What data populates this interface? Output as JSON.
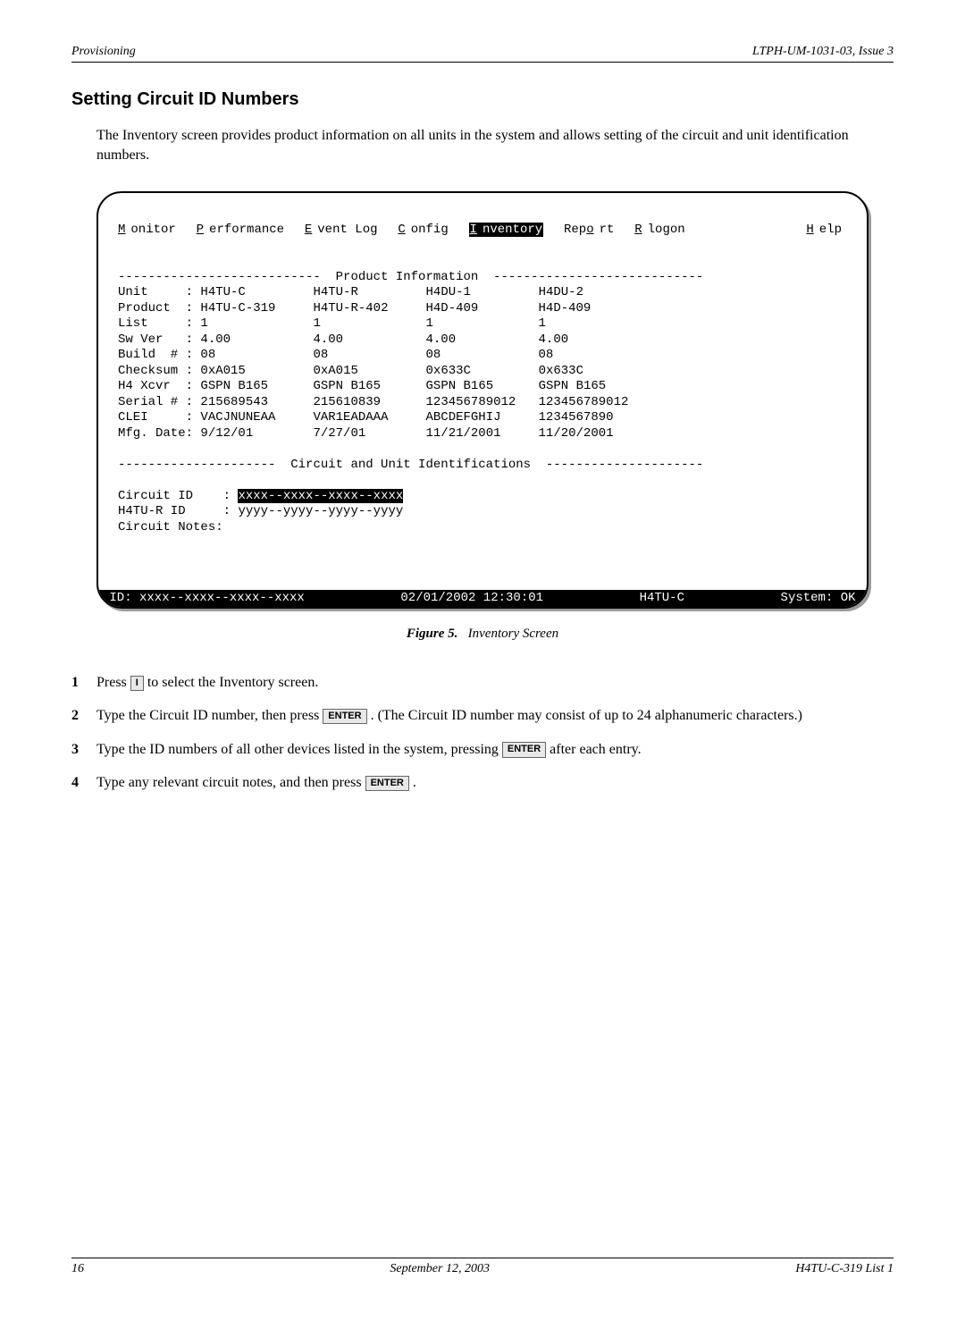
{
  "header": {
    "left": "Provisioning",
    "right": "LTPH-UM-1031-03, Issue 3"
  },
  "title": "Setting Circuit ID Numbers",
  "intro": "The Inventory screen provides product information on all units in the system and allows setting of the circuit and unit identification numbers.",
  "terminal": {
    "menu": {
      "monitor": "Monitor",
      "performance": "Performance",
      "eventlog": "Event Log",
      "config": "Config",
      "inventory": "Inventory",
      "report": "Report",
      "rlogon": "Rlogon",
      "help": "Help"
    },
    "section1_title": "Product Information",
    "labels": {
      "unit": "Unit     :",
      "product": "Product  :",
      "list": "List     :",
      "swver": "Sw Ver   :",
      "build": "Build  # :",
      "checksum": "Checksum :",
      "h4xcvr": "H4 Xcvr  :",
      "serial": "Serial # :",
      "clei": "CLEI     :",
      "mfg": "Mfg. Date:"
    },
    "cols": {
      "c1": {
        "unit": "H4TU-C",
        "product": "H4TU-C-319",
        "list": "1",
        "swver": "4.00",
        "build": "08",
        "checksum": "0xA015",
        "h4xcvr": "GSPN B165",
        "serial": "215689543",
        "clei": "VACJNUNEAA",
        "mfg": "9/12/01"
      },
      "c2": {
        "unit": "H4TU-R",
        "product": "H4TU-R-402",
        "list": "1",
        "swver": "4.00",
        "build": "08",
        "checksum": "0xA015",
        "h4xcvr": "GSPN B165",
        "serial": "215610839",
        "clei": "VAR1EADAAA",
        "mfg": "7/27/01"
      },
      "c3": {
        "unit": "H4DU-1",
        "product": "H4D-409",
        "list": "1",
        "swver": "4.00",
        "build": "08",
        "checksum": "0x633C",
        "h4xcvr": "GSPN B165",
        "serial": "123456789012",
        "clei": "ABCDEFGHIJ",
        "mfg": "11/21/2001"
      },
      "c4": {
        "unit": "H4DU-2",
        "product": "H4D-409",
        "list": "1",
        "swver": "4.00",
        "build": "08",
        "checksum": "0x633C",
        "h4xcvr": "GSPN B165",
        "serial": "123456789012",
        "clei": "1234567890",
        "mfg": "11/20/2001"
      }
    },
    "section2_title": "Circuit and Unit Identifications",
    "circuit_id_label": "Circuit ID    :",
    "circuit_id_value": "xxxx--xxxx--xxxx--xxxx",
    "h4tur_id_label": "H4TU-R ID     :",
    "h4tur_id_value": "yyyy--yyyy--yyyy--yyyy",
    "notes_label": "Circuit Notes:",
    "status": {
      "id": " ID: xxxx--xxxx--xxxx--xxxx",
      "datetime": "02/01/2002 12:30:01",
      "unit": "H4TU-C",
      "system": "System: OK "
    }
  },
  "figure": {
    "label": "Figure 5.",
    "title": "Inventory Screen"
  },
  "steps": {
    "s1a": "Press ",
    "s1key": "I",
    "s1b": " to select the Inventory screen.",
    "s2a": "Type the Circuit ID number, then press ",
    "s2key": "ENTER",
    "s2b": " . (The Circuit ID number may consist of up to 24 alphanumeric characters.)",
    "s3a": "Type the ID numbers of all other devices listed in the system, pressing ",
    "s3key": "ENTER",
    "s3b": " after each entry.",
    "s4a": "Type any relevant circuit notes, and then press ",
    "s4key": "ENTER",
    "s4b": " ."
  },
  "footer": {
    "left": "16",
    "center": "September 12, 2003",
    "right": "H4TU-C-319 List 1"
  }
}
